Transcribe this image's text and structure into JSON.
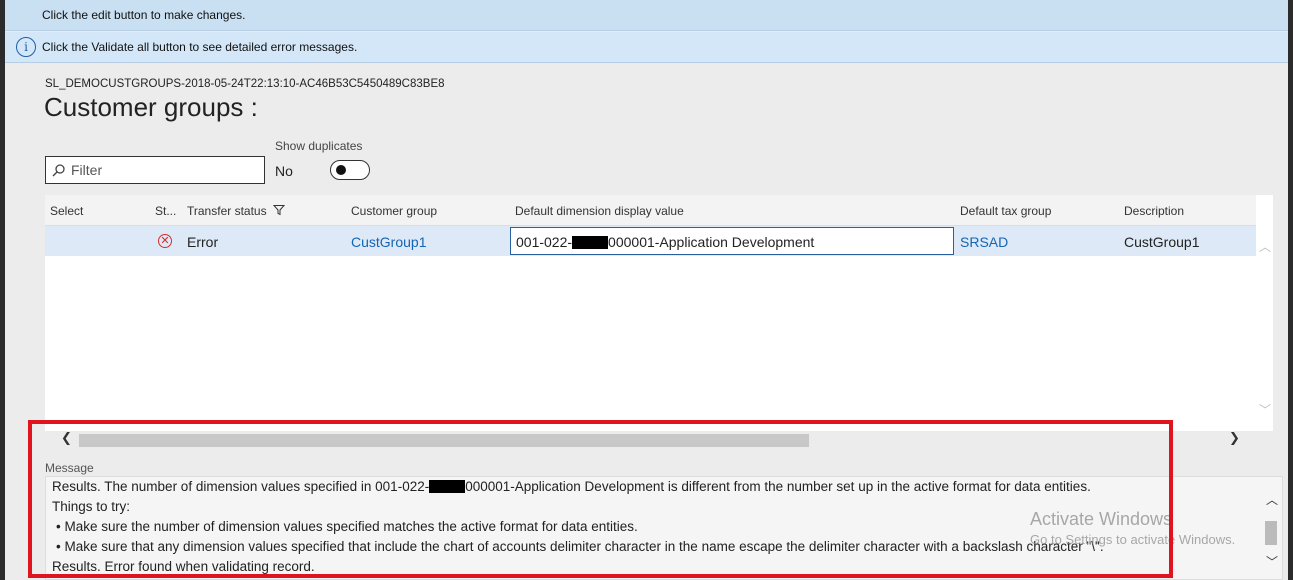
{
  "banners": {
    "edit": "Click the edit button to make changes.",
    "validate": "Click the Validate all button to see detailed error messages."
  },
  "record_id": "SL_DEMOCUSTGROUPS-2018-05-24T22:13:10-AC46B53C5450489C83BE8",
  "title": "Customer groups :",
  "filter": {
    "placeholder": "Filter"
  },
  "show_duplicates": {
    "label": "Show duplicates",
    "value": "No"
  },
  "grid": {
    "columns": {
      "select": "Select",
      "status": "St...",
      "transfer_status": "Transfer status",
      "customer_group": "Customer group",
      "default_dimension": "Default dimension display value",
      "default_tax_group": "Default tax group",
      "description": "Description"
    },
    "rows": [
      {
        "transfer_status": "Error",
        "customer_group": "CustGroup1",
        "dim_prefix": "001-022-",
        "dim_suffix": "000001-Application Development",
        "default_tax_group": "SRSAD",
        "description": "CustGroup1"
      }
    ]
  },
  "message": {
    "label": "Message",
    "line1_prefix": "Results. The number of dimension values specified in 001-022-",
    "line1_suffix": "000001-Application Development is different from the number set up in the active format for data entities.",
    "line2": "Things to try:",
    "line3": "• Make sure the number of dimension values specified matches the active format for data entities.",
    "line4": "• Make sure that any dimension values specified that include the chart of accounts delimiter character in the name escape the delimiter character with a backslash character \"\\\".",
    "line5": "Results. Error found when validating record."
  },
  "watermark": {
    "title": "Activate Windows",
    "subtitle": "Go to Settings to activate Windows."
  },
  "colors": {
    "banner": "#c9dff2",
    "link": "#1565b3",
    "error": "#d32f2f",
    "highlight": "#e0141e",
    "row_selected": "#dde9f6"
  }
}
